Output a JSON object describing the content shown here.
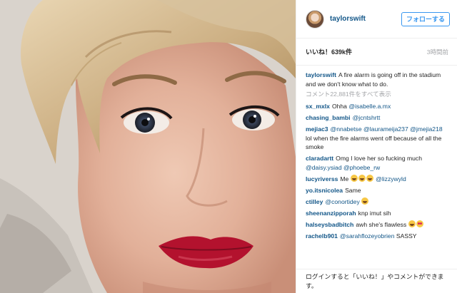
{
  "post": {
    "image_alt": "selfie photo",
    "colors": {
      "link": "#125688",
      "follow": "#3897f0",
      "muted": "#a5a7aa"
    }
  },
  "header": {
    "username": "taylorswift",
    "follow_label": "フォローする"
  },
  "stats": {
    "likes": "いいね！639k件",
    "time_ago": "3時間前"
  },
  "caption": {
    "user": "taylorswift",
    "text": "A fire alarm is going off in the stadium and we don't know what to do."
  },
  "view_all_comments": "コメント22,881件をすべて表示",
  "comments": [
    {
      "user": "sx_mxlx",
      "parts": [
        {
          "t": "Ohha "
        },
        {
          "m": "@isabelle.a.mx"
        }
      ]
    },
    {
      "user": "chasing_bambi",
      "parts": [
        {
          "m": "@jcntshrtt"
        }
      ]
    },
    {
      "user": "mejiac3",
      "parts": [
        {
          "m": "@nnabetse"
        },
        {
          "t": " "
        },
        {
          "m": "@laurameija237"
        },
        {
          "t": " "
        },
        {
          "m": "@jmejia218"
        },
        {
          "t": " lol when the fire alarms went off because of all the smoke"
        }
      ]
    },
    {
      "user": "claradartt",
      "parts": [
        {
          "t": "Omg I love her so fucking much "
        },
        {
          "m": "@daisy.ysiad"
        },
        {
          "t": " "
        },
        {
          "m": "@phoebe_rw"
        }
      ]
    },
    {
      "user": "lucyriverss",
      "parts": [
        {
          "t": "Me "
        },
        {
          "e": "joy"
        },
        {
          "e": "joy"
        },
        {
          "e": "joy"
        },
        {
          "t": " "
        },
        {
          "m": "@lizzywyld"
        }
      ]
    },
    {
      "user": "yo.itsnicolea",
      "parts": [
        {
          "t": "Same"
        }
      ]
    },
    {
      "user": "ctilley",
      "parts": [
        {
          "m": "@conortidey"
        },
        {
          "t": " "
        },
        {
          "e": "joy"
        }
      ]
    },
    {
      "user": "sheenanzipporah",
      "parts": [
        {
          "t": "knp imut sih"
        }
      ]
    },
    {
      "user": "halseysbadbitch",
      "parts": [
        {
          "t": "awh she's flawless "
        },
        {
          "e": "joy"
        },
        {
          "e": "heart-eyes"
        }
      ]
    },
    {
      "user": "rachelb901",
      "parts": [
        {
          "m": "@sarahflozeyobrien"
        },
        {
          "t": " SASSY"
        }
      ]
    }
  ],
  "footer": {
    "login_prompt": "ログインすると「いいね！」やコメントができます。"
  }
}
